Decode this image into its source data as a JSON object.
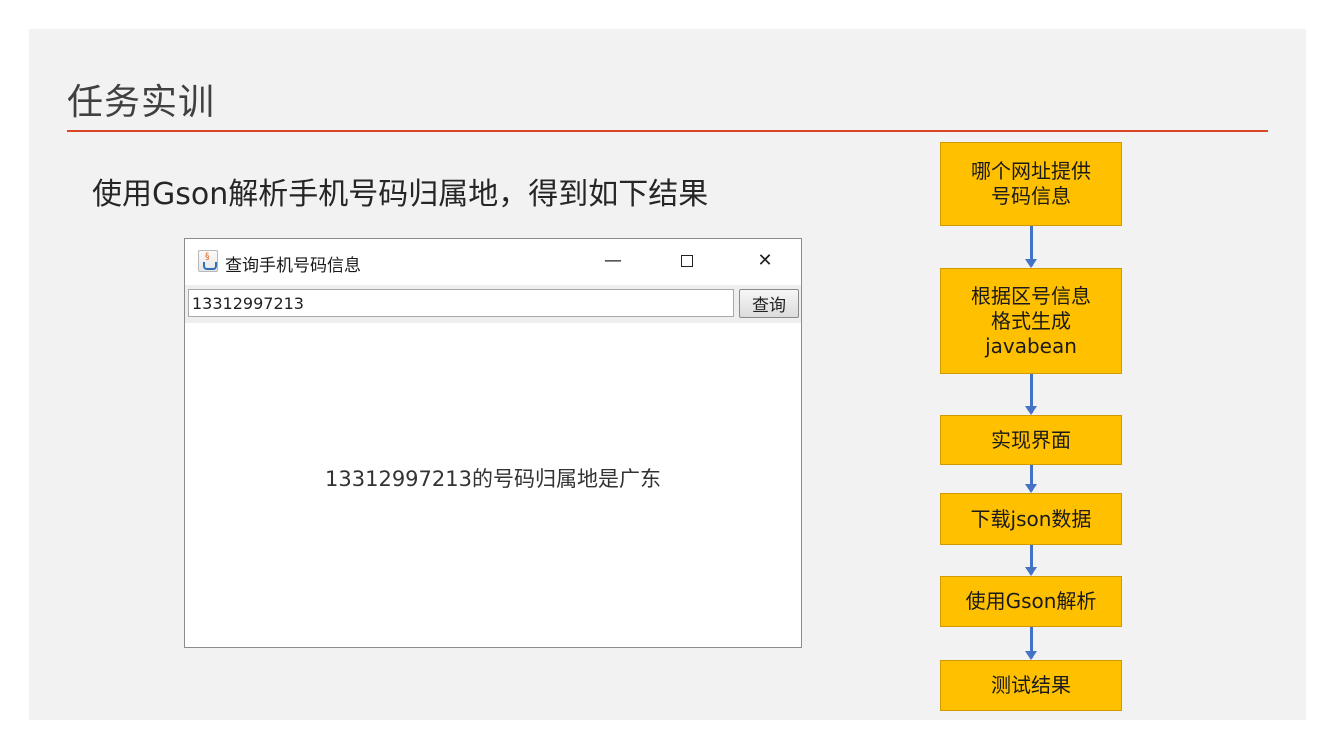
{
  "slide": {
    "title": "任务实训",
    "subtitle": "使用Gson解析手机号码归属地，得到如下结果"
  },
  "app_window": {
    "title": "查询手机号码信息",
    "minimize_glyph": "—",
    "close_glyph": "✕",
    "phone_input_value": "13312997213",
    "query_button_label": "查询",
    "result_text": "13312997213的号码归属地是广东"
  },
  "flowchart": {
    "steps": [
      "哪个网址提供号码信息",
      "根据区号信息格式生成javabean",
      "实现界面",
      "下载json数据",
      "使用Gson解析",
      "测试结果"
    ],
    "step_lines": [
      [
        "哪个网址提供",
        "号码信息"
      ],
      [
        "根据区号信息",
        "格式生成",
        "javabean"
      ],
      [
        "实现界面"
      ],
      [
        "下载json数据"
      ],
      [
        "使用Gson解析"
      ],
      [
        "测试结果"
      ]
    ]
  },
  "colors": {
    "title_rule": "#d9472b",
    "flow_box_fill": "#ffc000",
    "flow_arrow": "#4472c4",
    "slide_background": "#f2f2f2"
  },
  "icons": {
    "app_icon": "java-coffee-cup-icon",
    "minimize": "minimize-icon",
    "maximize": "maximize-icon",
    "close": "close-icon"
  }
}
